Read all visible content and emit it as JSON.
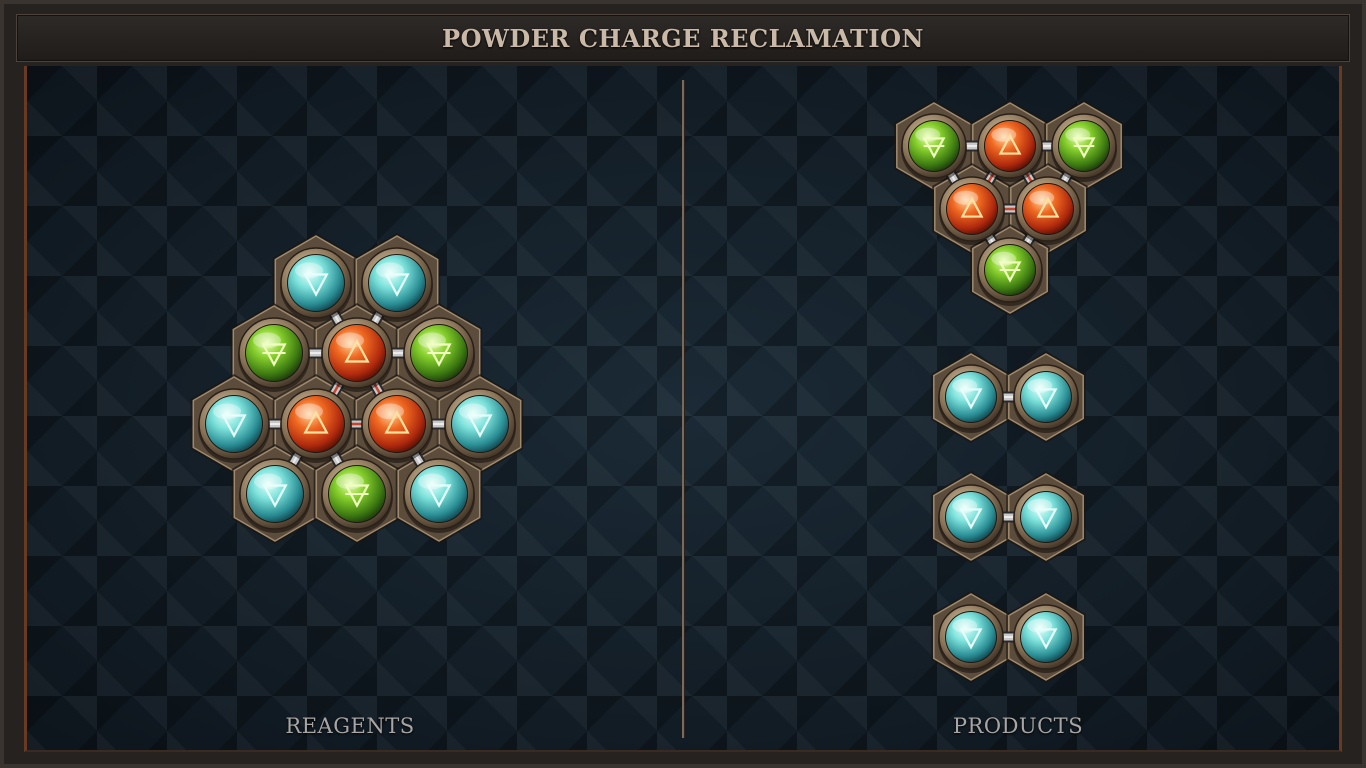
{
  "header": {
    "title": "POWDER CHARGE RECLAMATION"
  },
  "sections": {
    "reagents_label": "REAGENTS",
    "products_label": "PRODUCTS"
  },
  "glyphs": {
    "water": "water-element-icon",
    "earth": "earth-element-icon",
    "fire": "fire-element-icon"
  },
  "colors": {
    "water": "#5ed6d0",
    "earth": "#6fbe2a",
    "fire": "#e2521e",
    "bronze": "#8a7458"
  },
  "reagents": {
    "molecule": "reagent-hex-cluster",
    "atoms": [
      "water",
      "water",
      "earth",
      "fire",
      "earth",
      "water",
      "fire",
      "fire",
      "water",
      "water",
      "earth",
      "water"
    ]
  },
  "products": [
    {
      "molecule": "product-triangle-cluster",
      "atoms": [
        "earth",
        "fire",
        "earth",
        "fire",
        "fire",
        "earth"
      ]
    },
    {
      "molecule": "product-water-pair",
      "atoms": [
        "water",
        "water"
      ]
    },
    {
      "molecule": "product-water-pair",
      "atoms": [
        "water",
        "water"
      ]
    },
    {
      "molecule": "product-water-pair",
      "atoms": [
        "water",
        "water"
      ]
    }
  ]
}
